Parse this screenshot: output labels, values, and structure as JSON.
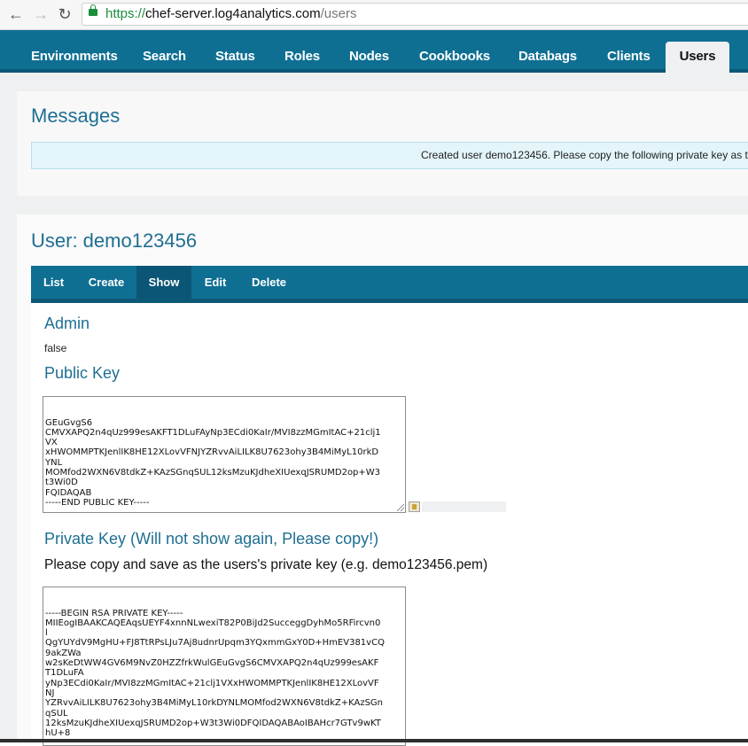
{
  "browser": {
    "url_scheme": "https://",
    "url_host": "chef-server.log4analytics.com",
    "url_path": "/users"
  },
  "topnav": {
    "items": [
      "Environments",
      "Search",
      "Status",
      "Roles",
      "Nodes",
      "Cookbooks",
      "Databags",
      "Clients",
      "Users"
    ],
    "active": "Users"
  },
  "messages": {
    "title": "Messages",
    "alert": "Created user demo123456. Please copy the following private key as t"
  },
  "user": {
    "title": "User: demo123456",
    "subnav": [
      "List",
      "Create",
      "Show",
      "Edit",
      "Delete"
    ],
    "active_tab": "Show",
    "admin_label": "Admin",
    "admin_value": "false",
    "public_key_label": "Public Key",
    "public_key": "GEuGvgS6\nCMVXAPQ2n4qUz999esAKFT1DLuFAyNp3ECdi0KaIr/MVI8zzMGmItAC+21clj1\nVX\nxHWOMMPTKJenlIK8HE12XLovVFNJYZRvvAiLILK8U7623ohy3B4MiMyL10rkD\nYNL\nMOMfod2WXN6V8tdkZ+KAzSGnqSUL12ksMzuKJdheXIUexqJSRUMD2op+W3\nt3Wi0D\nFQIDAQAB\n-----END PUBLIC KEY-----",
    "private_key_label": "Private Key (Will not show again, Please copy!)",
    "private_key_note": "Please copy and save as the users's private key (e.g. demo123456.pem)",
    "private_key": "-----BEGIN RSA PRIVATE KEY-----\nMIIEogIBAAKCAQEAqsUEYF4xnnNLwexiT82P0BiJd2SucceggDyhMo5RFircvn0\nl\nQgYUYdV9MgHU+FJ8TtRPsLJu7Aj8udnrUpqm3YQxmmGxY0D+HmEV381vCQ\n9akZWa\nw2sKeDtWW4GV6M9NvZ0HZZfrkWulGEuGvgS6CMVXAPQ2n4qUz999esAKF\nT1DLuFA\nyNp3ECdi0KaIr/MVI8zzMGmItAC+21clj1VXxHWOMMPTKJenlIK8HE12XLovVF\nNJ\nYZRvvAiLILK8U7623ohy3B4MiMyL10rkDYNLMOMfod2WXN6V8tdkZ+KAzSGn\nqSUL\n12ksMzuKJdheXIUexqJSRUMD2op+W3t3Wi0DFQIDAQABAoIBAHcr7GTv9wKT\nhU+8"
  }
}
